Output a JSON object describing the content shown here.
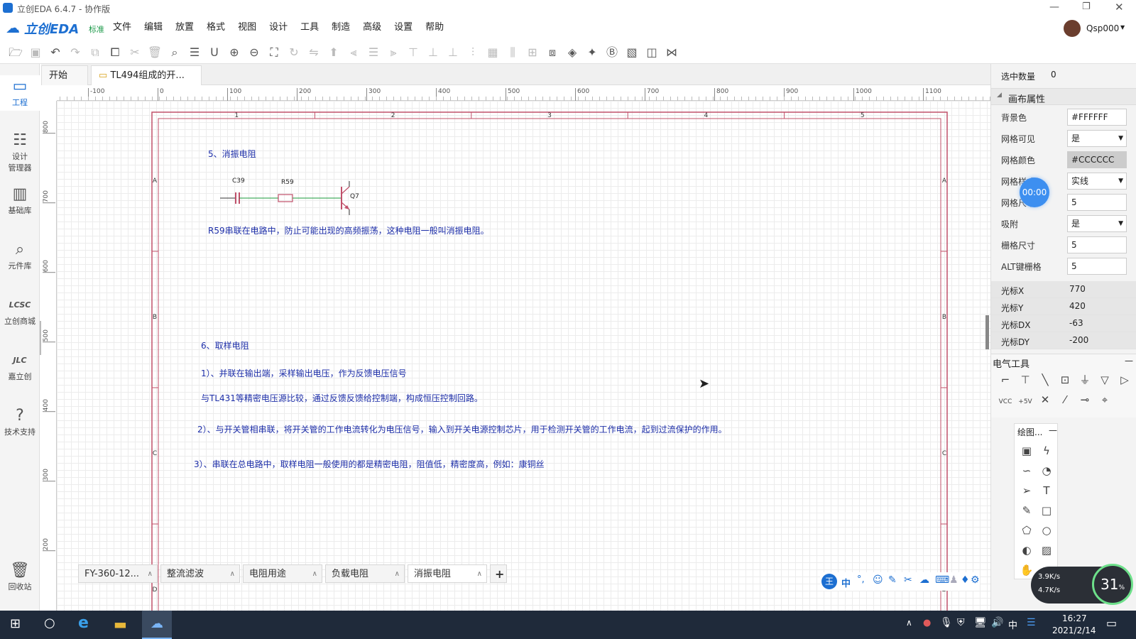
{
  "window": {
    "title": "立创EDA 6.4.7 - 协作版"
  },
  "menubar": {
    "logo": "立创EDA",
    "edition": "标准",
    "items": [
      "文件",
      "编辑",
      "放置",
      "格式",
      "视图",
      "设计",
      "工具",
      "制造",
      "高级",
      "设置",
      "帮助"
    ],
    "user": "Qsp000"
  },
  "sidebar": {
    "items": [
      {
        "label": "工程",
        "icon": "folder-icon"
      },
      {
        "label": "设计\n管理器",
        "icon": "list-icon"
      },
      {
        "label": "基础库",
        "icon": "chip-icon"
      },
      {
        "label": "元件库",
        "icon": "search-component-icon"
      },
      {
        "label": "立创商城",
        "icon": "lcsc-icon"
      },
      {
        "label": "嘉立创",
        "icon": "jlc-icon"
      },
      {
        "label": "技术支持",
        "icon": "help-icon"
      },
      {
        "label": "回收站",
        "icon": "trash-icon"
      }
    ]
  },
  "tabs": [
    {
      "label": "开始"
    },
    {
      "label": "TL494组成的开..."
    }
  ],
  "ruler": {
    "top": [
      "-100",
      "0",
      "100",
      "200",
      "300",
      "400",
      "500",
      "600",
      "700",
      "800",
      "900",
      "1000",
      "1100"
    ],
    "left": [
      "800",
      "700",
      "600",
      "500",
      "400",
      "300",
      "200"
    ]
  },
  "frame": {
    "cols": [
      "1",
      "2",
      "3",
      "4",
      "5"
    ],
    "rows": [
      "A",
      "B",
      "C",
      "D"
    ]
  },
  "schematic": {
    "heading5": "5、消振电阻",
    "c_label": "C39",
    "r_label": "R59",
    "q_label": "Q7",
    "note5": "R59串联在电路中，防止可能出现的高频振荡，这种电阻一般叫消振电阻。",
    "heading6": "6、取样电阻",
    "note6_1": "1）、并联在输出端，采样输出电压，作为反馈电压信号",
    "note6_1b": "与TL431等精密电压源比较，通过反馈反馈给控制端，构成恒压控制回路。",
    "note6_2": "2）、与开关管相串联，将开关管的工作电流转化为电压信号，输入到开关电源控制芯片，用于检测开关管的工作电流，起到过流保护的作用。",
    "note6_3": "3）、串联在总电路中，取样电阻一般使用的都是精密电阻，阻值低，精密度高，例如：康铜丝"
  },
  "bottom_tabs": [
    "FY-360-12...",
    "整流滤波",
    "电阻用途",
    "负载电阻",
    "消振电阻"
  ],
  "add_tab": "+",
  "panel": {
    "selected_label": "选中数量",
    "selected_value": "0",
    "section": "画布属性",
    "props": [
      {
        "label": "背景色",
        "value": "#FFFFFF",
        "select": false
      },
      {
        "label": "网格可见",
        "value": "是",
        "select": true
      },
      {
        "label": "网格颜色",
        "value": "#CCCCCC",
        "select": false
      },
      {
        "label": "网格样式",
        "value": "实线",
        "select": true
      },
      {
        "label": "网格尺寸",
        "value": "5",
        "select": false
      },
      {
        "label": "吸附",
        "value": "是",
        "select": true
      },
      {
        "label": "栅格尺寸",
        "value": "5",
        "select": false
      },
      {
        "label": "ALT键栅格",
        "value": "5",
        "select": false
      }
    ],
    "readouts": [
      {
        "label": "光标X",
        "value": "770"
      },
      {
        "label": "光标Y",
        "value": "420"
      },
      {
        "label": "光标DX",
        "value": "-63"
      },
      {
        "label": "光标DY",
        "value": "-200"
      }
    ],
    "timer": "00:00",
    "etools_title": "电气工具",
    "draw_title": "绘图..."
  },
  "netspeed": {
    "up": "3.9K/s",
    "down": "4.7K/s",
    "percent": "31"
  },
  "taskbar": {
    "time": "16:27",
    "date": "2021/2/14",
    "ime": "中"
  },
  "colors": {
    "accent": "#1d6fd1",
    "note": "#1d2ea8",
    "frame": "#c0506a"
  }
}
